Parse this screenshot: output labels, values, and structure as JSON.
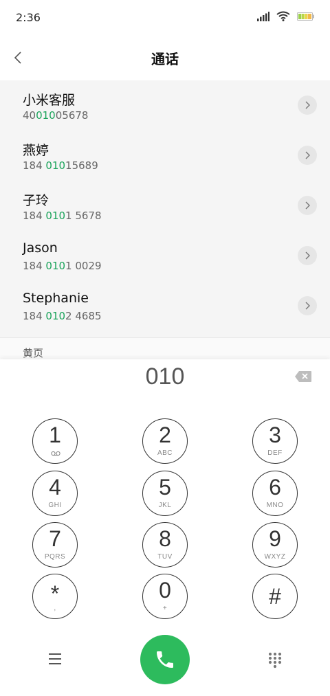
{
  "status_bar": {
    "time": "2:36"
  },
  "header": {
    "title": "通话"
  },
  "contacts": [
    {
      "name": "小米客服",
      "number_pre": "40",
      "number_hl": "010",
      "number_post": "05678"
    },
    {
      "name": "燕婷",
      "number_pre": "184 ",
      "number_hl": "010",
      "number_post": "15689"
    },
    {
      "name": "子玲",
      "number_pre": "184 ",
      "number_hl": "010",
      "number_post": "1 5678"
    },
    {
      "name": "Jason",
      "number_pre": "184 ",
      "number_hl": "010",
      "number_post": "1 0029"
    },
    {
      "name": "Stephanie",
      "number_pre": "184 ",
      "number_hl": "010",
      "number_post": "2 4685"
    }
  ],
  "section": {
    "label": "黄页"
  },
  "dialer": {
    "input": "010",
    "keys": [
      {
        "num": "1",
        "sub": ""
      },
      {
        "num": "2",
        "sub": "ABC"
      },
      {
        "num": "3",
        "sub": "DEF"
      },
      {
        "num": "4",
        "sub": "GHI"
      },
      {
        "num": "5",
        "sub": "JKL"
      },
      {
        "num": "6",
        "sub": "MNO"
      },
      {
        "num": "7",
        "sub": "PQRS"
      },
      {
        "num": "8",
        "sub": "TUV"
      },
      {
        "num": "9",
        "sub": "WXYZ"
      },
      {
        "num": "*",
        "sub": ","
      },
      {
        "num": "0",
        "sub": "+"
      },
      {
        "num": "#",
        "sub": ""
      }
    ]
  },
  "colors": {
    "highlight": "#1aa35a",
    "call_button": "#2dbb5d",
    "list_background": "#f5f5f5"
  },
  "icons": {
    "back": "chevron-left-icon",
    "row_action": "chevron-right-icon",
    "delete": "backspace-icon",
    "voicemail": "voicemail-icon",
    "menu": "menu-icon",
    "call": "phone-icon",
    "keypad": "keypad-icon"
  }
}
